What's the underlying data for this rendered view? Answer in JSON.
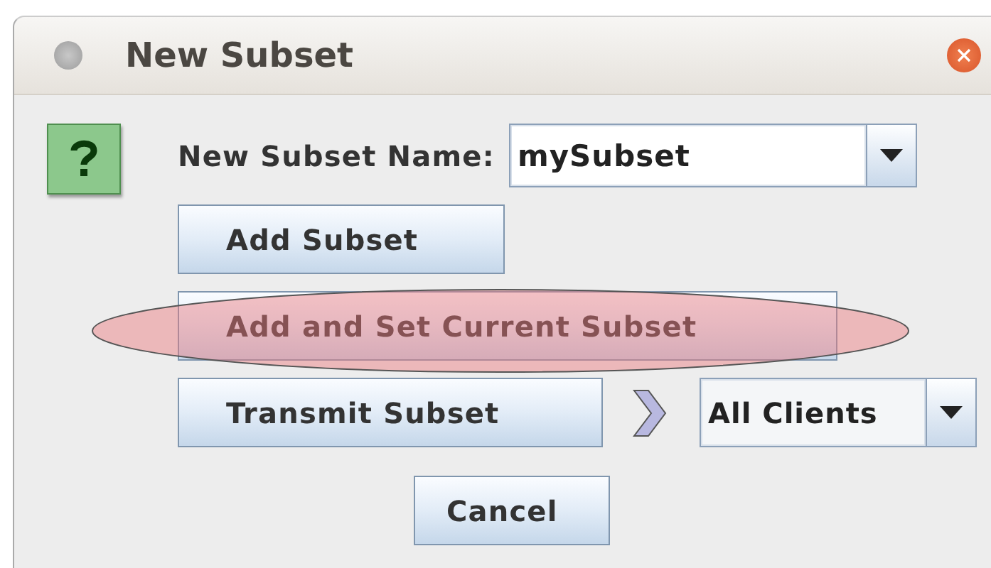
{
  "window": {
    "title": "New Subset"
  },
  "name_field": {
    "label": "New Subset Name:",
    "value": "mySubset"
  },
  "buttons": [
    {
      "label": "Add Subset",
      "highlighted": false
    },
    {
      "label": "Add and Set Current Subset",
      "highlighted": true
    }
  ],
  "transmit": {
    "button": "Transmit Subset",
    "target": "All Clients"
  },
  "cancel": "Cancel"
}
